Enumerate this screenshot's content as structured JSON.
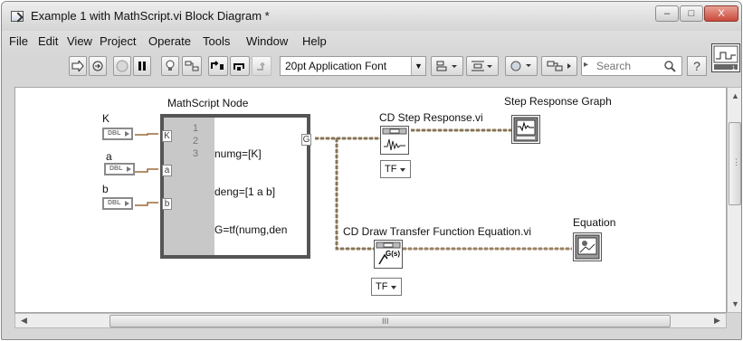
{
  "window": {
    "title": "Example 1 with MathScript.vi Block Diagram *",
    "controls": {
      "minimize": "–",
      "maximize": "□",
      "close": "X"
    }
  },
  "menu": [
    "File",
    "Edit",
    "View",
    "Project",
    "Operate",
    "Tools",
    "Window",
    "Help"
  ],
  "toolbar": {
    "font": "20pt Application Font",
    "search_placeholder": "Search",
    "help": "?"
  },
  "diagram": {
    "mathscript_label": "MathScript Node",
    "controls": [
      {
        "label": "K",
        "type": "DBL"
      },
      {
        "label": "a",
        "type": "DBL"
      },
      {
        "label": "b",
        "type": "DBL"
      }
    ],
    "input_terminals": [
      "K",
      "a",
      "b"
    ],
    "output_terminal": "G",
    "line_numbers": [
      "1",
      "2",
      "3"
    ],
    "code_lines": [
      "numg=[K]",
      "deng=[1 a b]",
      "G=tf(numg,den"
    ],
    "step_vi_label": "CD Step Response.vi",
    "step_graph_label": "Step Response Graph",
    "draw_tf_label": "CD Draw Transfer Function Equation.vi",
    "equation_label": "Equation",
    "tf_selector_1": "TF",
    "tf_selector_2": "TF"
  },
  "scrollbar": {
    "grip": "⋮",
    "hgrip": "III"
  }
}
